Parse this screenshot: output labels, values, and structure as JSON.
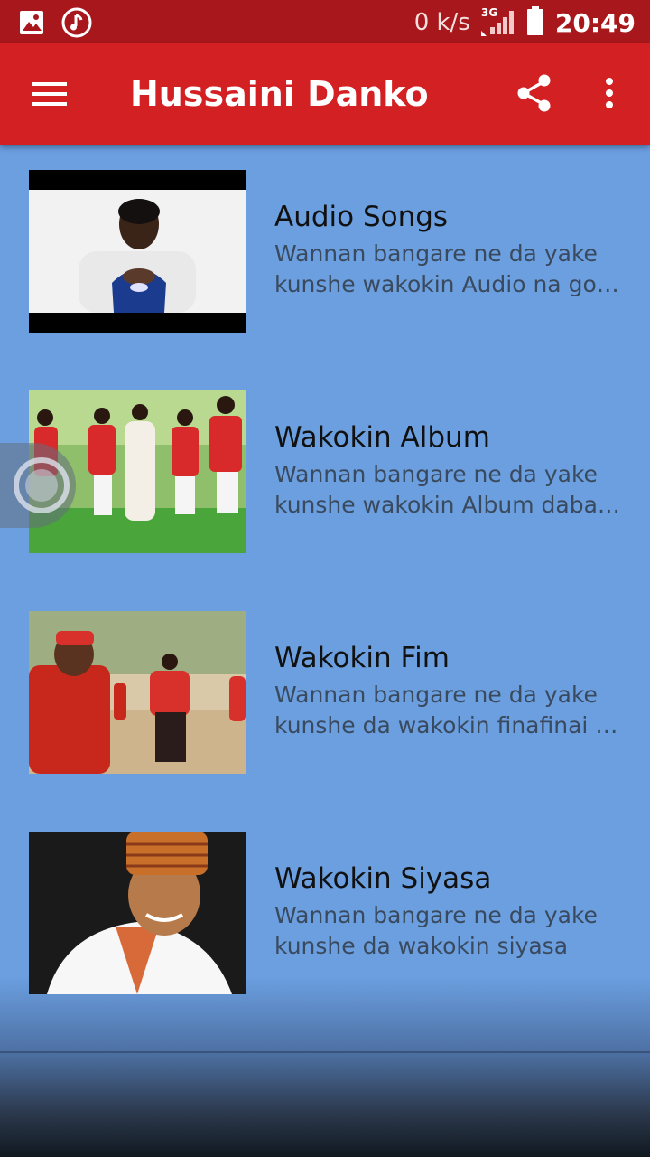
{
  "status_bar": {
    "net_speed": "0 k/s",
    "network": "3G",
    "time": "20:49",
    "icons": [
      "image-icon",
      "music-note-icon",
      "signal-icon",
      "battery-icon"
    ]
  },
  "toolbar": {
    "title": "Hussaini Danko",
    "icons": [
      "hamburger-menu-icon",
      "share-icon",
      "more-vert-icon"
    ]
  },
  "colors": {
    "status_bar": "#a8171b",
    "toolbar": "#d32023",
    "background": "#6b9fe0"
  },
  "items": [
    {
      "title": "Audio Songs",
      "desc1": "Wannan bangare ne da yake",
      "desc2": "kunshe wakokin Audio na go…"
    },
    {
      "title": "Wakokin Album",
      "desc1": "Wannan bangare ne da yake",
      "desc2": "kunshe wakokin Album daba…"
    },
    {
      "title": "Wakokin Fim",
      "desc1": "Wannan bangare ne da yake",
      "desc2": "kunshe da wakokin finafinai d…"
    },
    {
      "title": "Wakokin Siyasa",
      "desc1": "Wannan bangare ne da yake",
      "desc2": "kunshe da wakokin siyasa"
    }
  ]
}
